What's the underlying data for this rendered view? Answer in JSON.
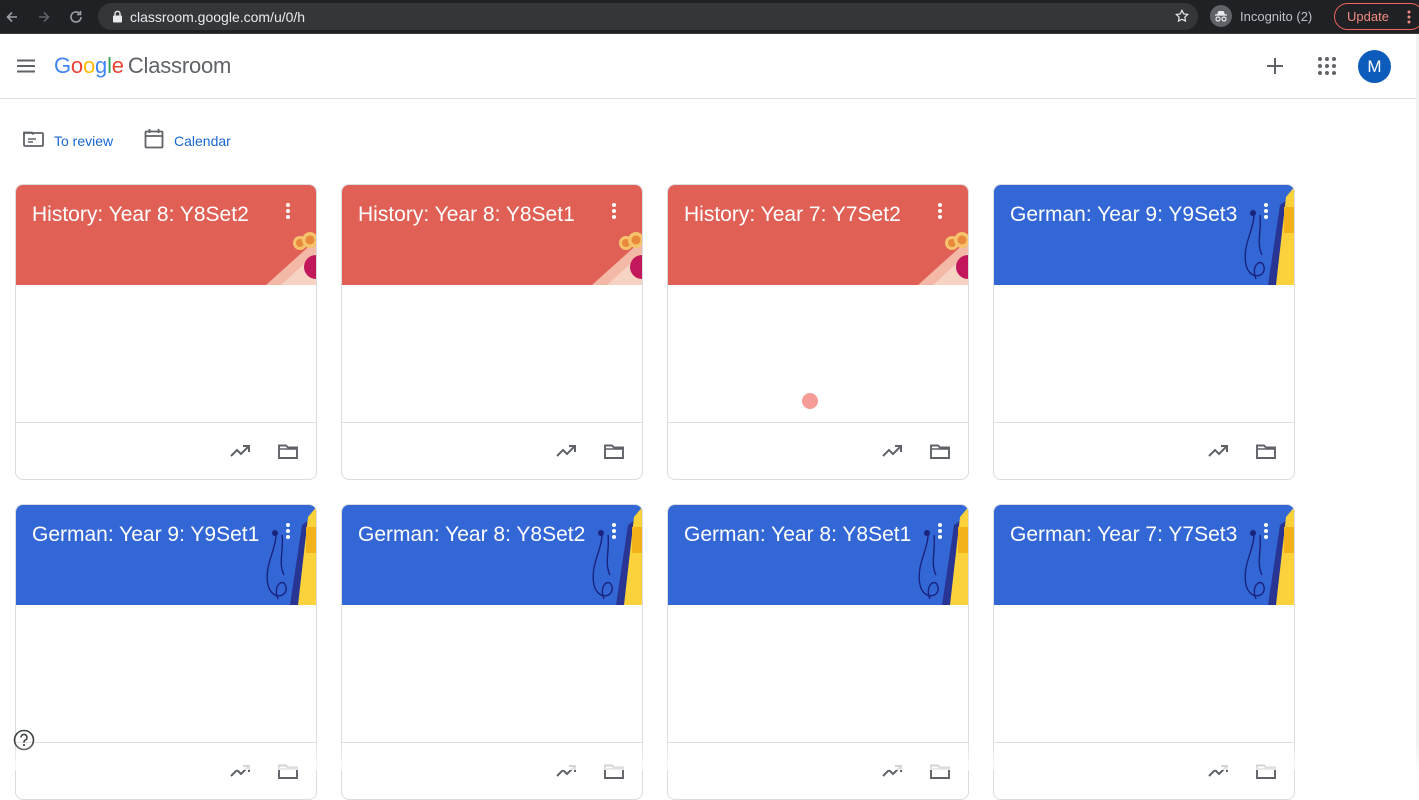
{
  "browser": {
    "url": "classroom.google.com/u/0/h",
    "incognito_label": "Incognito (2)",
    "update_label": "Update"
  },
  "app": {
    "logo_letters": [
      "G",
      "o",
      "o",
      "g",
      "l",
      "e"
    ],
    "product_name": "Classroom",
    "avatar_initial": "M"
  },
  "subnav": {
    "to_review": "To review",
    "calendar": "Calendar"
  },
  "colors": {
    "history_banner": "#e06055",
    "german_banner": "#3367d6",
    "link": "#1967d2",
    "avatar": "#0d5bba"
  },
  "courses": [
    {
      "title": "History: Year 8: Y8Set2",
      "theme": "red"
    },
    {
      "title": "History: Year 8: Y8Set1",
      "theme": "red"
    },
    {
      "title": "History: Year 7: Y7Set2",
      "theme": "red"
    },
    {
      "title": "German: Year 9: Y9Set3",
      "theme": "blue"
    },
    {
      "title": "German: Year 9: Y9Set1",
      "theme": "blue"
    },
    {
      "title": "German: Year 8: Y8Set2",
      "theme": "blue"
    },
    {
      "title": "German: Year 8: Y8Set1",
      "theme": "blue"
    },
    {
      "title": "German: Year 7: Y7Set3",
      "theme": "blue"
    }
  ],
  "icons": {
    "card_menu": "more-vert-icon",
    "gradebook": "trending-up-icon",
    "drive_folder": "folder-icon",
    "help": "help-icon"
  }
}
